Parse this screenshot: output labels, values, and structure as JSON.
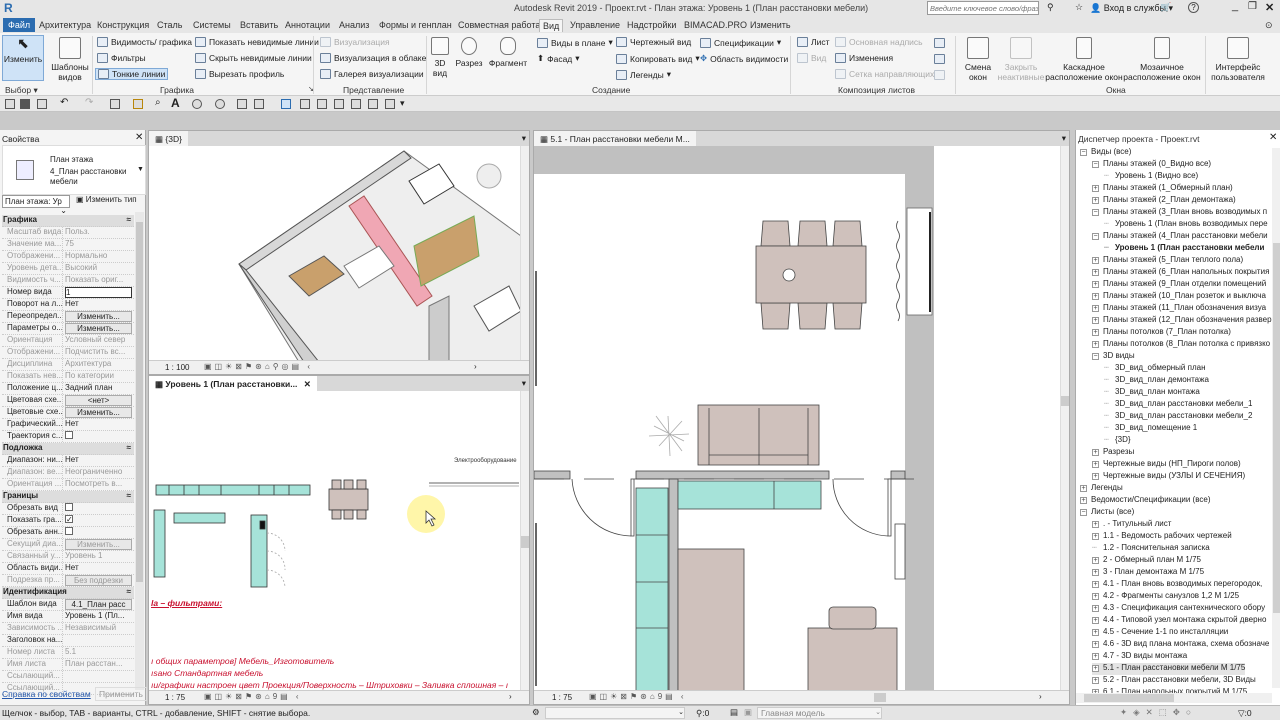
{
  "app": {
    "title": "Autodesk Revit 2019 - Проект.rvt - План этажа: Уровень 1 (План расстановки мебели)",
    "search_placeholder": "Введите ключевое слово/фразу",
    "sign_in": "Вход в службы",
    "help": "?"
  },
  "tabs": [
    "Файл",
    "Архитектура",
    "Конструкция",
    "Сталь",
    "Системы",
    "Вставить",
    "Аннотации",
    "Анализ",
    "Формы и генплан",
    "Совместная работа",
    "Вид",
    "Управление",
    "Надстройки",
    "BIMACAD.PRO",
    "Изменить"
  ],
  "active_tab": "Вид",
  "ribbon": {
    "modify": "Изменить",
    "templates": [
      "Шаблоны",
      "видов"
    ],
    "graphics": [
      "Видимость/ графика",
      "Фильтры",
      "Тонкие линии"
    ],
    "lines": [
      "Показать невидимые линии",
      "Скрыть невидимые линии",
      "Вырезать профиль"
    ],
    "render": [
      "Визуализация",
      "Визуализация в облаке",
      "Галерея визуализации"
    ],
    "view3d": [
      "3D",
      "вид"
    ],
    "section": "Разрез",
    "callout": "Фрагмент",
    "create1": [
      "Виды в плане",
      "Фасад"
    ],
    "create2": [
      "Чертежный вид",
      "Копировать вид",
      "Легенды"
    ],
    "create3": [
      "Спецификации",
      "Область видимости"
    ],
    "sheet": [
      "Лист",
      "Вид"
    ],
    "sheet2": [
      "Основная надпись",
      "Изменения",
      "Сетка направляющих"
    ],
    "switch": [
      "Смена",
      "окон"
    ],
    "close_inactive": [
      "Закрыть",
      "неактивные"
    ],
    "cascade": [
      "Каскадное",
      "расположение окон"
    ],
    "tile": [
      "Мозаичное",
      "расположение окон"
    ],
    "ui": [
      "Интерфейс",
      "пользователя"
    ],
    "panels": [
      "Выбор",
      "Графика",
      "Представление",
      "Создание",
      "Композиция листов",
      "Окна"
    ]
  },
  "properties": {
    "title": "Свойства",
    "type_line1": "План этажа",
    "type_line2": "4_План расстановки мебели",
    "selector": "План этажа: Ур",
    "edit_type": "Изменить тип",
    "rows": [
      {
        "h": "Графика"
      },
      {
        "l": "Масштаб вида",
        "v": "Польз.",
        "d": 1
      },
      {
        "l": "Значение ма...",
        "v": "75",
        "d": 1
      },
      {
        "l": "Отображени...",
        "v": "Нормально",
        "d": 1
      },
      {
        "l": "Уровень дета...",
        "v": "Высокий",
        "d": 1
      },
      {
        "l": "Видимость ч...",
        "v": "Показать ориг...",
        "d": 1
      },
      {
        "l": "Номер вида",
        "v": "1",
        "t": "input"
      },
      {
        "l": "Поворот на л...",
        "v": "Нет"
      },
      {
        "l": "Переопредел...",
        "v": "Изменить...",
        "t": "button"
      },
      {
        "l": "Параметры о...",
        "v": "Изменить...",
        "t": "button"
      },
      {
        "l": "Ориентация",
        "v": "Условный север",
        "d": 1
      },
      {
        "l": "Отображени...",
        "v": "Подчистить вс...",
        "d": 1
      },
      {
        "l": "Дисциплина",
        "v": "Архитектура",
        "d": 1
      },
      {
        "l": "Показать нев...",
        "v": "По категории",
        "d": 1
      },
      {
        "l": "Положение ц...",
        "v": "Задний план"
      },
      {
        "l": "Цветовая схе...",
        "v": "<нет>",
        "t": "button"
      },
      {
        "l": "Цветовые схе...",
        "v": "Изменить...",
        "t": "button"
      },
      {
        "l": "Графический...",
        "v": "Нет"
      },
      {
        "l": "Траектория с...",
        "v": "",
        "t": "check",
        "c": 0
      },
      {
        "h": "Подложка"
      },
      {
        "l": "Диапазон: ни...",
        "v": "Нет"
      },
      {
        "l": "Диапазон: ве...",
        "v": "Неограниченно",
        "d": 1
      },
      {
        "l": "Ориентация ...",
        "v": "Посмотреть в...",
        "d": 1
      },
      {
        "h": "Границы"
      },
      {
        "l": "Обрезать вид",
        "v": "",
        "t": "check",
        "c": 0
      },
      {
        "l": "Показать гра...",
        "v": "",
        "t": "check",
        "c": 1
      },
      {
        "l": "Обрезать анн...",
        "v": "",
        "t": "check",
        "c": 0
      },
      {
        "l": "Секущий диа...",
        "v": "Изменить...",
        "t": "button",
        "d": 1
      },
      {
        "l": "Связанный у...",
        "v": "Уровень 1",
        "d": 1
      },
      {
        "l": "Область види...",
        "v": "Нет"
      },
      {
        "l": "Подрезка пр...",
        "v": "Без подрезки",
        "t": "button",
        "d": 1
      },
      {
        "h": "Идентификация"
      },
      {
        "l": "Шаблон вида",
        "v": "4.1_План расс",
        "t": "button"
      },
      {
        "l": "Имя вида",
        "v": "Уровень 1 (Пл..."
      },
      {
        "l": "Зависимость ...",
        "v": "Независимый",
        "d": 1
      },
      {
        "l": "Заголовок на...",
        "v": ""
      },
      {
        "l": "Номер листа",
        "v": "5.1",
        "d": 1
      },
      {
        "l": "Имя листа",
        "v": "План расстан...",
        "d": 1
      },
      {
        "l": "Ссылающий...",
        "v": "",
        "d": 1
      },
      {
        "l": "Ссылающий...",
        "v": "",
        "d": 1
      }
    ],
    "help_link": "Справка по свойствам",
    "apply": "Применить"
  },
  "views": {
    "v3d": {
      "tab": "{3D}",
      "scale": "1 : 100"
    },
    "plan": {
      "tab": "Уровень 1 (План расстановки...",
      "scale": "1 : 75",
      "label_electrical": "Электрооборудование",
      "notes": [
        "la – фильтрами:",
        "ı общих параметров] Мебель_Изготовитель",
        "ısано Стандартная мебель",
        "ıи/графики настроен цвет Проекция/Поверхность – Штриховки – Заливка сплошная – ı"
      ]
    },
    "sheet": {
      "tab": "5.1 - План расстановки мебели М...",
      "scale": "1 : 75"
    }
  },
  "browser": {
    "title": "Диспетчер проекта - Проект.rvt",
    "items": [
      {
        "t": "Виды (все)",
        "lv": 0,
        "e": "-"
      },
      {
        "t": "Планы этажей (0_Видно все)",
        "lv": 1,
        "e": "-"
      },
      {
        "t": "Уровень 1 (Видно все)",
        "lv": 2
      },
      {
        "t": "Планы этажей (1_Обмерный план)",
        "lv": 1,
        "e": "+"
      },
      {
        "t": "Планы этажей (2_План демонтажа)",
        "lv": 1,
        "e": "+"
      },
      {
        "t": "Планы этажей (3_План вновь возводимых п",
        "lv": 1,
        "e": "-"
      },
      {
        "t": "Уровень 1 (План вновь возводимых пере",
        "lv": 2
      },
      {
        "t": "Планы этажей (4_План расстановки мебели",
        "lv": 1,
        "e": "-"
      },
      {
        "t": "Уровень 1 (План расстановки мебели",
        "lv": 2,
        "b": 1
      },
      {
        "t": "Планы этажей (5_План теплого пола)",
        "lv": 1,
        "e": "+"
      },
      {
        "t": "Планы этажей (6_План напольных покрытия",
        "lv": 1,
        "e": "+"
      },
      {
        "t": "Планы этажей (9_План отделки помещений",
        "lv": 1,
        "e": "+"
      },
      {
        "t": "Планы этажей (10_План розеток и выключа",
        "lv": 1,
        "e": "+"
      },
      {
        "t": "Планы этажей (11_План обозначения визуа",
        "lv": 1,
        "e": "+"
      },
      {
        "t": "Планы этажей (12_План обозначения развер",
        "lv": 1,
        "e": "+"
      },
      {
        "t": "Планы потолков (7_План потолка)",
        "lv": 1,
        "e": "+"
      },
      {
        "t": "Планы потолков (8_План потолка с привязко",
        "lv": 1,
        "e": "+"
      },
      {
        "t": "3D виды",
        "lv": 1,
        "e": "-"
      },
      {
        "t": "3D_вид_обмерный план",
        "lv": 2
      },
      {
        "t": "3D_вид_план демонтажа",
        "lv": 2
      },
      {
        "t": "3D_вид_план монтажа",
        "lv": 2
      },
      {
        "t": "3D_вид_план расстановки мебели_1",
        "lv": 2
      },
      {
        "t": "3D_вид_план расстановки мебели_2",
        "lv": 2
      },
      {
        "t": "3D_вид_помещение 1",
        "lv": 2
      },
      {
        "t": "{3D}",
        "lv": 2
      },
      {
        "t": "Разрезы",
        "lv": 1,
        "e": "+"
      },
      {
        "t": "Чертежные виды (НП_Пироги полов)",
        "lv": 1,
        "e": "+"
      },
      {
        "t": "Чертежные виды (УЗЛЫ И СЕЧЕНИЯ)",
        "lv": 1,
        "e": "+"
      },
      {
        "t": "Легенды",
        "lv": 0,
        "e": "+"
      },
      {
        "t": "Ведомости/Спецификации (все)",
        "lv": 0,
        "e": "+"
      },
      {
        "t": "Листы (все)",
        "lv": 0,
        "e": "-"
      },
      {
        "t": ". - Титульный лист",
        "lv": 1,
        "e": "+"
      },
      {
        "t": "1.1 - Ведомость рабочих чертежей",
        "lv": 1,
        "e": "+"
      },
      {
        "t": "1.2 - Пояснительная записка",
        "lv": 1
      },
      {
        "t": "2 - Обмерный план М 1/75",
        "lv": 1,
        "e": "+"
      },
      {
        "t": "3 - План демонтажа М 1/75",
        "lv": 1,
        "e": "+"
      },
      {
        "t": "4.1 - План вновь возводимых перегородок,",
        "lv": 1,
        "e": "+"
      },
      {
        "t": "4.2 - Фрагменты санузлов 1,2 М 1/25",
        "lv": 1,
        "e": "+"
      },
      {
        "t": "4.3 - Спецификация сантехнического обору",
        "lv": 1,
        "e": "+"
      },
      {
        "t": "4.4 - Типовой узел монтажа скрытой дверно",
        "lv": 1,
        "e": "+"
      },
      {
        "t": "4.5 - Сечение 1-1 по инсталляции",
        "lv": 1,
        "e": "+"
      },
      {
        "t": "4.6 - 3D вид плана монтажа, схема обозначе",
        "lv": 1,
        "e": "+"
      },
      {
        "t": "4.7 - 3D виды монтажа",
        "lv": 1,
        "e": "+"
      },
      {
        "t": "5.1 - План расстановки мебели М 1/75",
        "lv": 1,
        "e": "+",
        "s": 1
      },
      {
        "t": "5.2 - План расстановки мебели, 3D Виды",
        "lv": 1,
        "e": "+"
      },
      {
        "t": "6.1 - План напольных покрытий М 1/75",
        "lv": 1,
        "e": "+"
      }
    ]
  },
  "status": {
    "hint": "Щелчок - выбор, TAB - варианты, CTRL - добавление, SHIFT - снятие выбора.",
    "worksets": ":0",
    "design_option": "Главная модель",
    "filter_count": ":0"
  },
  "colors": {
    "accent": "#2b6cb0",
    "teal": "#a6e3d9",
    "furniture": "#cfc1bc",
    "wall": "#c0c0c0",
    "note": "#c8102e"
  }
}
